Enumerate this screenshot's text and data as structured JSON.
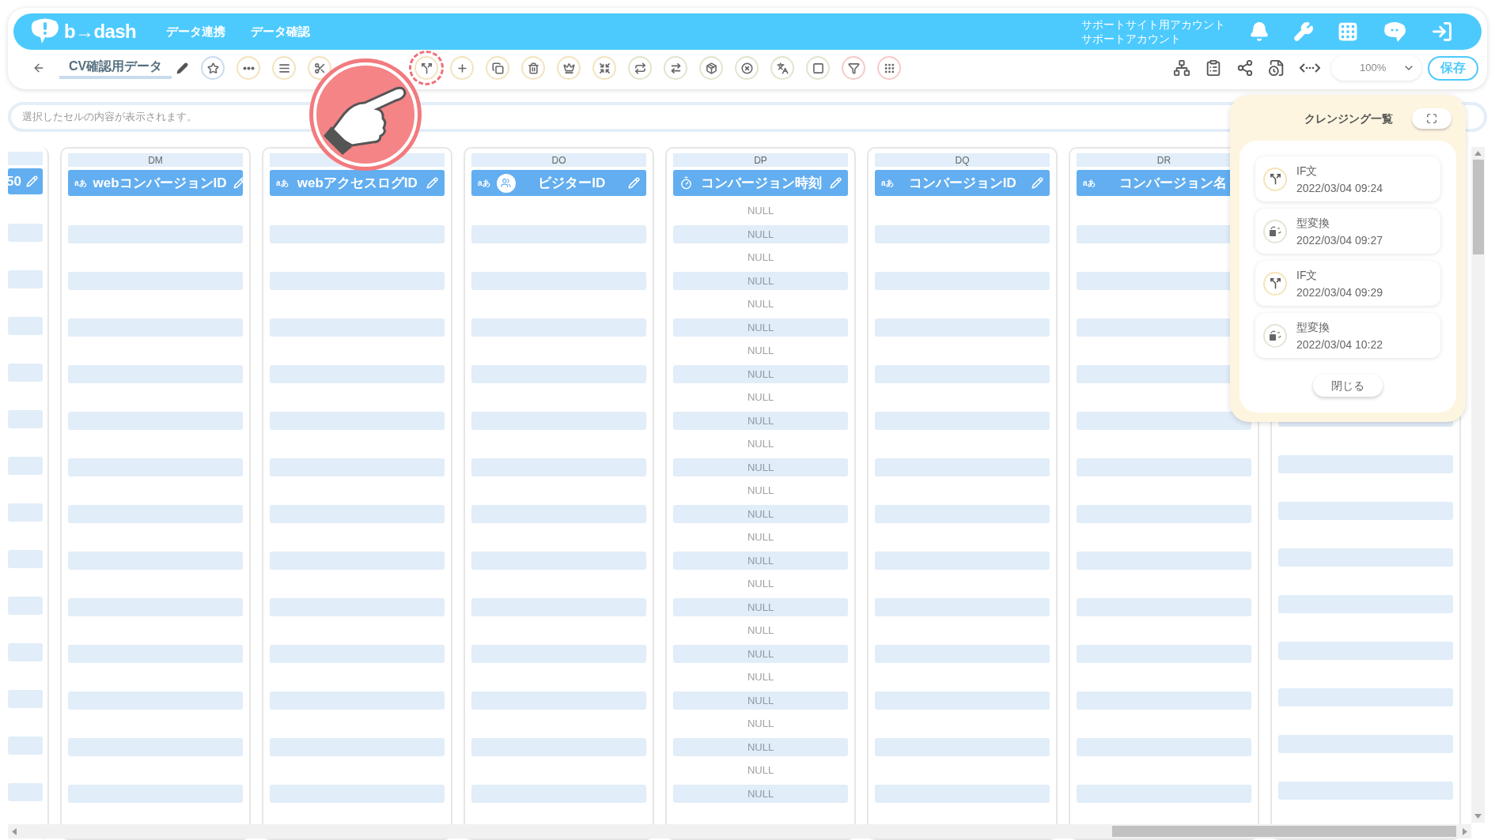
{
  "header": {
    "logo": "b→dash",
    "nav": [
      "データ連携",
      "データ確認"
    ],
    "account": [
      "サポートサイト用アカウント",
      "サポートアカウント"
    ]
  },
  "toolbar": {
    "title": "CV確認用データ",
    "tools": [
      {
        "kind": "star",
        "color": "#c7dcef"
      },
      {
        "kind": "dots",
        "color": "#f3e3bd"
      },
      {
        "kind": "lines",
        "color": "#f3e3bd"
      },
      {
        "kind": "scissors",
        "color": "#f3e3bd"
      },
      {
        "kind": "covered"
      },
      {
        "kind": "covered"
      },
      {
        "kind": "branch",
        "color": "#f3e3bd",
        "highlighted": true
      },
      {
        "kind": "plus",
        "color": "#f3e3bd"
      },
      {
        "kind": "copy",
        "color": "#f3e3bd"
      },
      {
        "kind": "trash",
        "color": "#f3e3bd"
      },
      {
        "kind": "crown",
        "color": "#f3e3bd"
      },
      {
        "kind": "shrink",
        "color": "#f3e3bd"
      },
      {
        "kind": "swap",
        "color": "#dfe6cc"
      },
      {
        "kind": "convert",
        "color": "#dfe6cc"
      },
      {
        "kind": "box",
        "color": "#dfe6cc"
      },
      {
        "kind": "xcircle",
        "color": "#dfe6cc"
      },
      {
        "kind": "translate",
        "color": "#dfe6cc"
      },
      {
        "kind": "zero",
        "color": "#dfe6cc"
      },
      {
        "kind": "filter",
        "color": "#f6c9c9"
      },
      {
        "kind": "grid",
        "color": "#f6c9c9"
      }
    ],
    "zoom": "100%",
    "save": "保存"
  },
  "formula_bar": {
    "placeholder": "選択したセルの内容が表示されます。"
  },
  "columns": [
    {
      "kind": "partial",
      "name": "50",
      "edit_icon": true
    },
    {
      "kind": "text",
      "type_label": "aあ",
      "letter": "DM",
      "name": "webコンバージョンID",
      "edit_icon": true
    },
    {
      "kind": "text",
      "type_label": "aあ",
      "name": "webアクセスログID",
      "edit_icon": true
    },
    {
      "kind": "text-group",
      "type_label": "aあ",
      "letter": "DO",
      "name": "ビジターID",
      "edit_icon": true
    },
    {
      "kind": "time",
      "letter": "DP",
      "name": "コンバージョン時刻",
      "edit_icon": true,
      "cells": [
        "NULL",
        "NULL",
        "NULL",
        "NULL",
        "NULL",
        "NULL",
        "NULL",
        "NULL",
        "NULL",
        "NULL",
        "NULL",
        "NULL",
        "NULL",
        "NULL",
        "NULL",
        "NULL",
        "NULL",
        "NULL",
        "NULL",
        "NULL",
        "NULL",
        "NULL",
        "NULL",
        "NULL",
        "NULL",
        "NULL"
      ]
    },
    {
      "kind": "text",
      "type_label": "aあ",
      "letter": "DQ",
      "name": "コンバージョンID",
      "edit_icon": true
    },
    {
      "kind": "text",
      "type_label": "aあ",
      "letter": "DR",
      "name": "コンバージョン名",
      "edit_icon": false
    },
    {
      "kind": "hidden"
    }
  ],
  "rows": [
    {
      "shaded": false
    },
    {
      "shaded": true
    },
    {
      "shaded": false
    },
    {
      "shaded": true
    },
    {
      "shaded": false
    },
    {
      "shaded": true
    },
    {
      "shaded": false
    },
    {
      "shaded": true
    },
    {
      "shaded": false
    },
    {
      "shaded": true
    },
    {
      "shaded": false
    },
    {
      "shaded": true
    },
    {
      "shaded": false
    },
    {
      "shaded": true
    },
    {
      "shaded": false
    },
    {
      "shaded": true
    },
    {
      "shaded": false
    },
    {
      "shaded": true
    },
    {
      "shaded": false
    },
    {
      "shaded": true
    },
    {
      "shaded": false
    },
    {
      "shaded": true
    },
    {
      "shaded": false
    },
    {
      "shaded": true
    },
    {
      "shaded": false
    },
    {
      "shaded": true
    }
  ],
  "cleansing_panel": {
    "title": "クレンジング一覧",
    "items": [
      {
        "kind": "if",
        "name": "IF文",
        "time": "2022/03/04 09:24"
      },
      {
        "kind": "type",
        "name": "型変換",
        "time": "2022/03/04 09:27"
      },
      {
        "kind": "if",
        "name": "IF文",
        "time": "2022/03/04 09:29"
      },
      {
        "kind": "type",
        "name": "型変換",
        "time": "2022/03/04 10:22"
      }
    ],
    "close": "閉じる"
  }
}
